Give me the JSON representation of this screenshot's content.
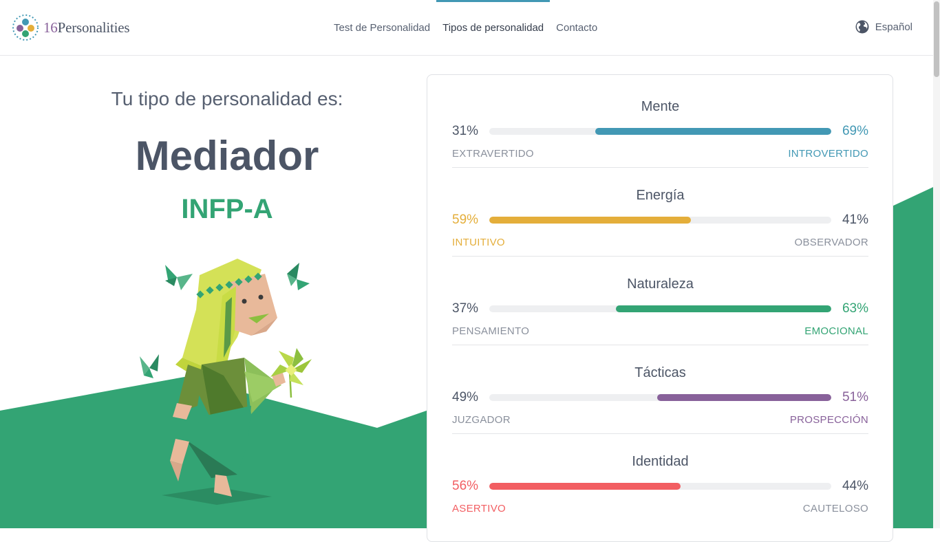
{
  "header": {
    "logo_number": "16",
    "logo_text": "Personalities",
    "nav": [
      {
        "label": "Test de Personalidad"
      },
      {
        "label": "Tipos de personalidad"
      },
      {
        "label": "Contacto"
      }
    ],
    "language": "Español"
  },
  "main": {
    "intro": "Tu tipo de personalidad es:",
    "type_name": "Mediador",
    "type_code": "INFP-A"
  },
  "traits": [
    {
      "title": "Mente",
      "left_pct": "31%",
      "right_pct": "69%",
      "left_label": "EXTRAVERTIDO",
      "right_label": "INTROVERTIDO",
      "dominant": "right",
      "value": 69,
      "color": "#4298b4"
    },
    {
      "title": "Energía",
      "left_pct": "59%",
      "right_pct": "41%",
      "left_label": "INTUITIVO",
      "right_label": "OBSERVADOR",
      "dominant": "left",
      "value": 59,
      "color": "#e4ae3a"
    },
    {
      "title": "Naturaleza",
      "left_pct": "37%",
      "right_pct": "63%",
      "left_label": "PENSAMIENTO",
      "right_label": "EMOCIONAL",
      "dominant": "right",
      "value": 63,
      "color": "#33a474"
    },
    {
      "title": "Tácticas",
      "left_pct": "49%",
      "right_pct": "51%",
      "left_label": "JUZGADOR",
      "right_label": "PROSPECCIÓN",
      "dominant": "right",
      "value": 51,
      "color": "#88619a"
    },
    {
      "title": "Identidad",
      "left_pct": "56%",
      "right_pct": "44%",
      "left_label": "ASERTIVO",
      "right_label": "CAUTELOSO",
      "dominant": "left",
      "value": 56,
      "color": "#f25e62"
    }
  ],
  "colors": {
    "accent": "#4298b4",
    "green": "#33a474",
    "text_dark": "#4c5566"
  },
  "icons": {
    "language": "globe-icon",
    "logo": "logo-dots-icon"
  }
}
